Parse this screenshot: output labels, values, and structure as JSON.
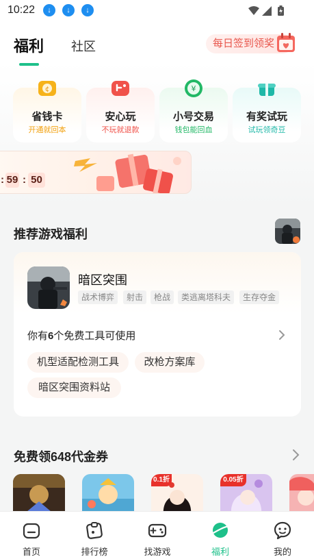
{
  "status_bar": {
    "time": "10:22"
  },
  "header": {
    "tabs": [
      {
        "label": "福利",
        "active": true
      },
      {
        "label": "社区",
        "active": false
      }
    ],
    "checkin_label": "每日签到领奖"
  },
  "features": [
    {
      "title": "省钱卡",
      "subtitle": "开通就回本",
      "icon": "money-card-icon",
      "accent": "#f2a10f"
    },
    {
      "title": "安心玩",
      "subtitle": "不玩就退款",
      "icon": "safe-play-icon",
      "accent": "#f0524a"
    },
    {
      "title": "小号交易",
      "subtitle": "钱包能回血",
      "icon": "account-trade-icon",
      "accent": "#22b866"
    },
    {
      "title": "有奖试玩",
      "subtitle": "试玩领奇豆",
      "icon": "trial-reward-icon",
      "accent": "#1fb8a8"
    }
  ],
  "banner": {
    "countdown": {
      "first": "59",
      "second": "50"
    }
  },
  "recommend": {
    "title": "推荐游戏福利",
    "game": {
      "name": "暗区突围",
      "tags": [
        "战术博弈",
        "射击",
        "枪战",
        "类逃离塔科夫",
        "生存夺金"
      ]
    },
    "tools_text_pre": "你有",
    "tools_count": "6",
    "tools_text_post": "个免费工具可使用",
    "tools": [
      "机型适配检测工具",
      "改枪方案库",
      "暗区突围资料站"
    ]
  },
  "voucher": {
    "title": "免费领648代金券",
    "badges": [
      "0.1折",
      "0.05折"
    ]
  },
  "nav": [
    {
      "label": "首页",
      "icon": "home-icon",
      "active": false
    },
    {
      "label": "排行榜",
      "icon": "ranking-icon",
      "active": false
    },
    {
      "label": "找游戏",
      "icon": "gamepad-icon",
      "active": false
    },
    {
      "label": "福利",
      "icon": "welfare-planet-icon",
      "active": true
    },
    {
      "label": "我的",
      "icon": "profile-chat-icon",
      "active": false
    }
  ],
  "colors": {
    "accent": "#1ec08a",
    "checkin": "#e8574d",
    "nav_active": "#1ec08a"
  }
}
